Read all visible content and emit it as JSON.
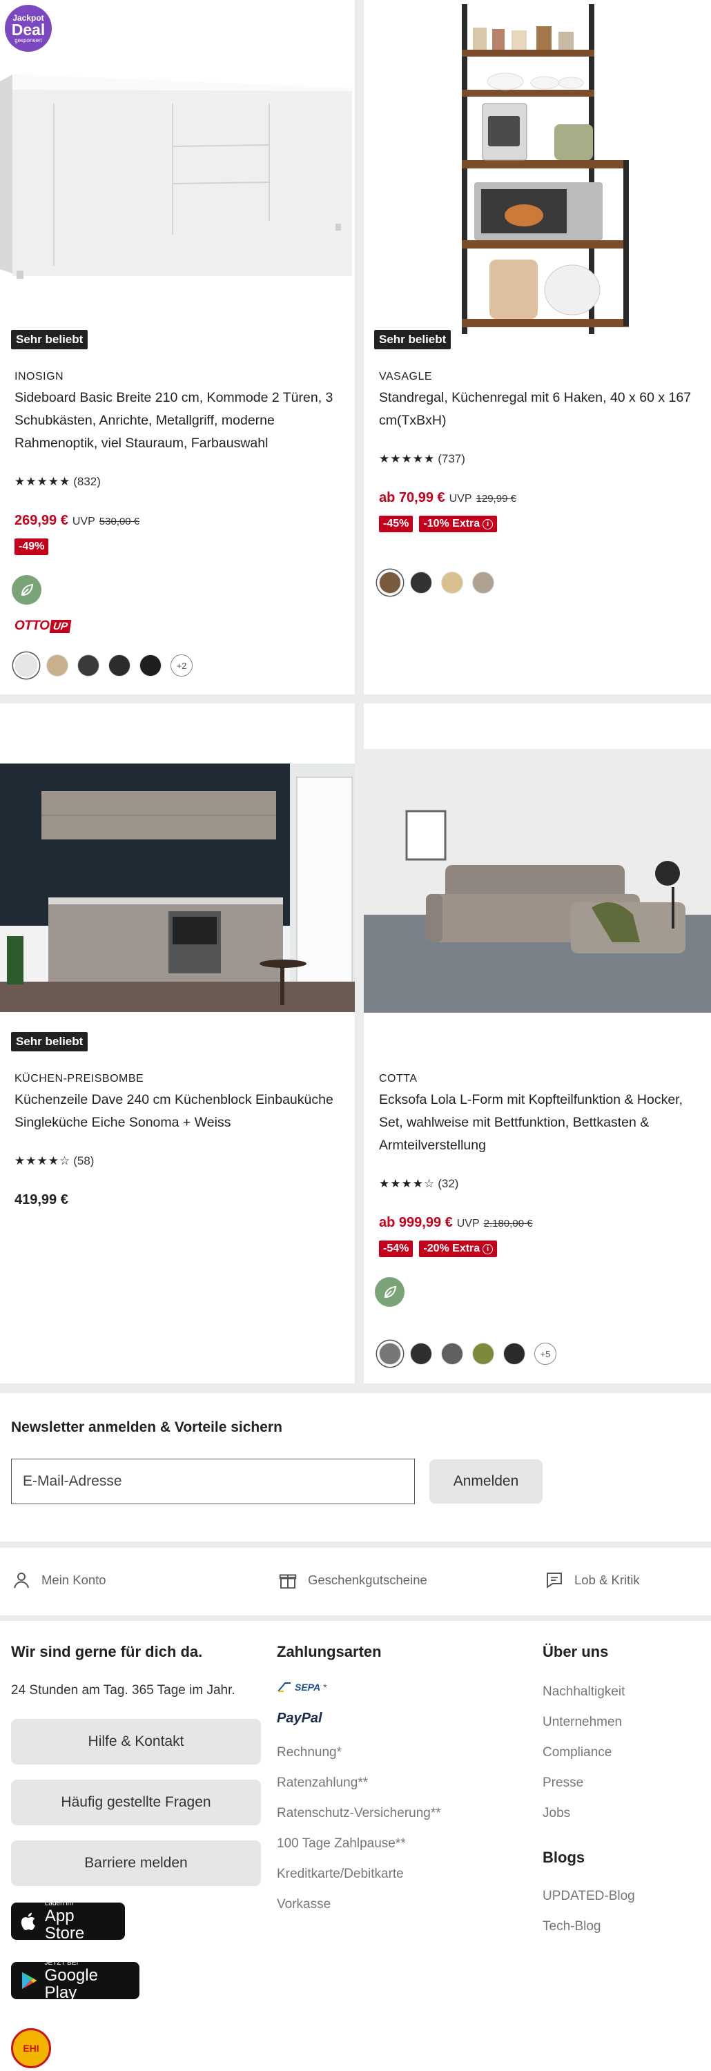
{
  "products": [
    {
      "badge": "Sehr beliebt",
      "jackpot": {
        "line1": "Jackpot",
        "line2": "Deal",
        "line3": "gesponsert"
      },
      "brand": "INOSIGN",
      "title_lines": [
        "Sideboard Basic Breite 210 cm, Kommode 2 Türen, 3",
        "Schubkästen, Anrichte, Metallgriff, moderne",
        "Rahmenoptik, viel Stauraum, Farbauswahl"
      ],
      "stars": "★★★★★",
      "rating_count": "(832)",
      "price": "269,99 €",
      "uvp_label": "UVP",
      "old_price": "530,00 €",
      "discount": "-49%",
      "otto_up": {
        "otto": "OTTO",
        "up": "UP"
      },
      "swatches": [
        "#e6e6e6",
        "#c8b08c",
        "#3a3a3a",
        "#2c2c2c",
        "#1e1e1e"
      ],
      "swatch_more": "+2"
    },
    {
      "badge": "Sehr beliebt",
      "brand": "VASAGLE",
      "title_lines": [
        "Standregal, Küchenregal mit 6 Haken, 40 x 60 x 167",
        "cm(TxBxH)"
      ],
      "stars": "★★★★★",
      "rating_count": "(737)",
      "price": "ab 70,99 €",
      "uvp_label": "UVP",
      "old_price": "129,99 €",
      "discount": "-45%",
      "extra": "-10% Extra",
      "swatches": [
        "#7a5a3e",
        "#333333",
        "#d8c08f",
        "#b0a293"
      ]
    },
    {
      "badge": "Sehr beliebt",
      "brand": "KÜCHEN-PREISBOMBE",
      "title_lines": [
        "Küchenzeile Dave 240 cm Küchenblock Einbauküche",
        "Singleküche Eiche Sonoma + Weiss"
      ],
      "stars": "★★★★☆",
      "rating_count": "(58)",
      "price": "419,99 €"
    },
    {
      "brand": "COTTA",
      "title_lines": [
        "Ecksofa Lola L-Form mit Kopfteilfunktion & Hocker,",
        "Set, wahlweise mit Bettfunktion, Bettkasten &",
        "Armteilverstellung"
      ],
      "stars": "★★★★☆",
      "rating_count": "(32)",
      "price": "ab 999,99 €",
      "uvp_label": "UVP",
      "old_price": "2.180,00 €",
      "discount": "-54%",
      "extra": "-20% Extra",
      "swatches": [
        "#777777",
        "#2f2f2f",
        "#606060",
        "#7d8a3c",
        "#2b2b2b"
      ],
      "swatch_more": "+5"
    }
  ],
  "newsletter": {
    "title": "Newsletter anmelden & Vorteile sichern",
    "placeholder": "E-Mail-Adresse",
    "button": "Anmelden"
  },
  "service": {
    "account": "Mein Konto",
    "vouchers": "Geschenkgutscheine",
    "feedback": "Lob & Kritik"
  },
  "footer": {
    "help": {
      "heading": "Wir sind gerne für dich da.",
      "hours": "24 Stunden am Tag. 365 Tage im Jahr.",
      "buttons": [
        "Hilfe & Kontakt",
        "Häufig gestellte Fragen",
        "Barriere melden"
      ]
    },
    "payment": {
      "heading": "Zahlungsarten",
      "sepa": "SEPA",
      "sepa_star": "*",
      "paypal": "PayPal",
      "items": [
        "Rechnung*",
        "Ratenzahlung**",
        "Ratenschutz-Versicherung**",
        "100 Tage Zahlpause**",
        "Kreditkarte/Debitkarte",
        "Vorkasse"
      ]
    },
    "about": {
      "heading": "Über uns",
      "items": [
        "Nachhaltigkeit",
        "Unternehmen",
        "Compliance",
        "Presse",
        "Jobs"
      ]
    },
    "blogs": {
      "heading": "Blogs",
      "items": [
        "UPDATED-Blog",
        "Tech-Blog"
      ]
    },
    "app_store": {
      "small": "Laden im",
      "big": "App Store"
    },
    "google_play": {
      "small": "JETZT BEI",
      "big": "Google Play"
    },
    "ehi": "EHI"
  }
}
